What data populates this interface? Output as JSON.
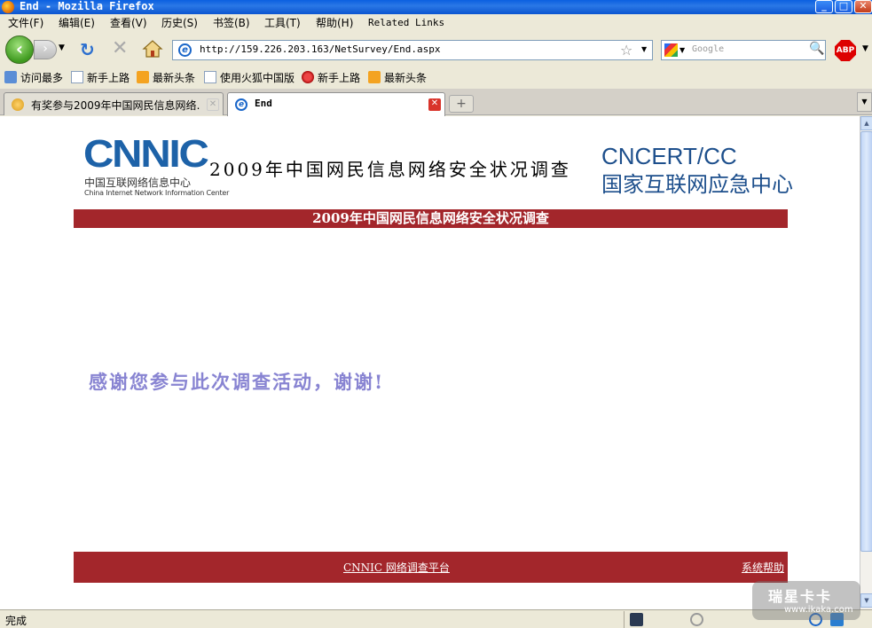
{
  "window": {
    "title": "End - Mozilla Firefox",
    "minimize_label": "_",
    "maximize_label": "□",
    "close_label": "✕"
  },
  "menu": {
    "items": [
      "文件(F)",
      "编辑(E)",
      "查看(V)",
      "历史(S)",
      "书签(B)",
      "工具(T)",
      "帮助(H)",
      "Related Links"
    ]
  },
  "nav": {
    "url": "http://159.226.203.163/NetSurvey/End.aspx",
    "search_placeholder": "Google",
    "adblock_label": "ABP"
  },
  "bookmarks": {
    "items": [
      {
        "label": "访问最多",
        "icon": "search-folder-icon"
      },
      {
        "label": "新手上路",
        "icon": "page-icon"
      },
      {
        "label": "最新头条",
        "icon": "feed-icon"
      },
      {
        "label": "使用火狐中国版",
        "icon": "page-icon"
      },
      {
        "label": "新手上路",
        "icon": "firefox-icon"
      },
      {
        "label": "最新头条",
        "icon": "feed-icon"
      }
    ]
  },
  "tabs": [
    {
      "label": "有奖参与2009年中国网民信息网络…",
      "active": false
    },
    {
      "label": "End",
      "active": true
    }
  ],
  "page": {
    "cnnic_logo_mark": "CNNIC",
    "cnnic_logo_cn": "中国互联网络信息中心",
    "cnnic_logo_en": "China Internet Network Information Center",
    "header_title": "2009年中国网民信息网络安全状况调查",
    "cncert_logo_mark": "CNCERT/CC",
    "cncert_logo_cn": "国家互联网应急中心",
    "bar_title": "2009年中国网民信息网络安全状况调查",
    "thanks_message": "感谢您参与此次调查活动，谢谢!",
    "footer_link_platform": "CNNIC 网络调查平台",
    "footer_link_help": "系统帮助"
  },
  "status": {
    "text": "完成"
  },
  "watermark": {
    "big": "瑞星卡卡",
    "small": "www.ikaka.com"
  },
  "colors": {
    "accent_red": "#a3262b",
    "thanks_text": "#8884d2",
    "cnnic_blue": "#1d62a8"
  }
}
